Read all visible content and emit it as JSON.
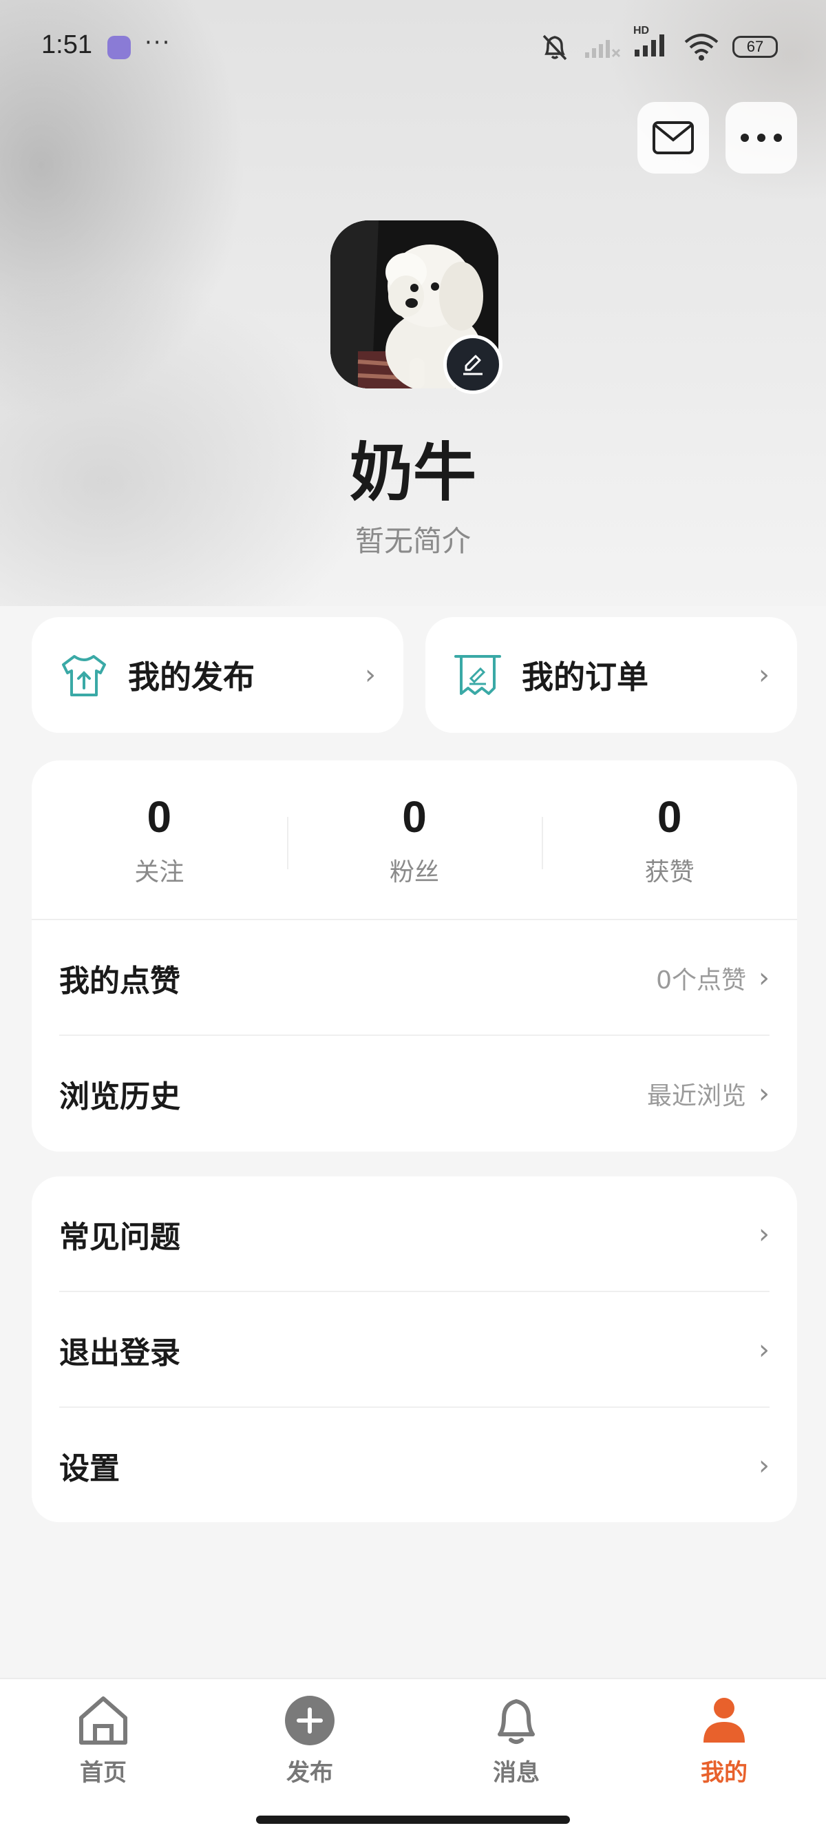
{
  "status_bar": {
    "time": "1:51",
    "more": "···",
    "battery": "67",
    "network_label": "HD"
  },
  "profile": {
    "name": "奶牛",
    "bio": "暂无简介"
  },
  "quick_actions": [
    {
      "label": "我的发布",
      "icon": "upload-shirt-icon"
    },
    {
      "label": "我的订单",
      "icon": "receipt-icon"
    }
  ],
  "stats": [
    {
      "value": "0",
      "label": "关注"
    },
    {
      "value": "0",
      "label": "粉丝"
    },
    {
      "value": "0",
      "label": "获赞"
    }
  ],
  "activity_rows": [
    {
      "title": "我的点赞",
      "extra": "0个点赞"
    },
    {
      "title": "浏览历史",
      "extra": "最近浏览"
    }
  ],
  "menu_rows": [
    {
      "title": "常见问题"
    },
    {
      "title": "退出登录"
    },
    {
      "title": "设置"
    }
  ],
  "tabs": [
    {
      "label": "首页",
      "icon": "home-icon",
      "active": false
    },
    {
      "label": "发布",
      "icon": "plus-circle-icon",
      "active": false
    },
    {
      "label": "消息",
      "icon": "bell-icon",
      "active": false
    },
    {
      "label": "我的",
      "icon": "person-icon",
      "active": true
    }
  ],
  "colors": {
    "accent": "#e8612c",
    "icon_teal": "#3aa9a6",
    "text_primary": "#1a1a1a",
    "text_secondary": "#8a8a8a",
    "page_background": "#f5f5f5"
  },
  "chevron": "›"
}
